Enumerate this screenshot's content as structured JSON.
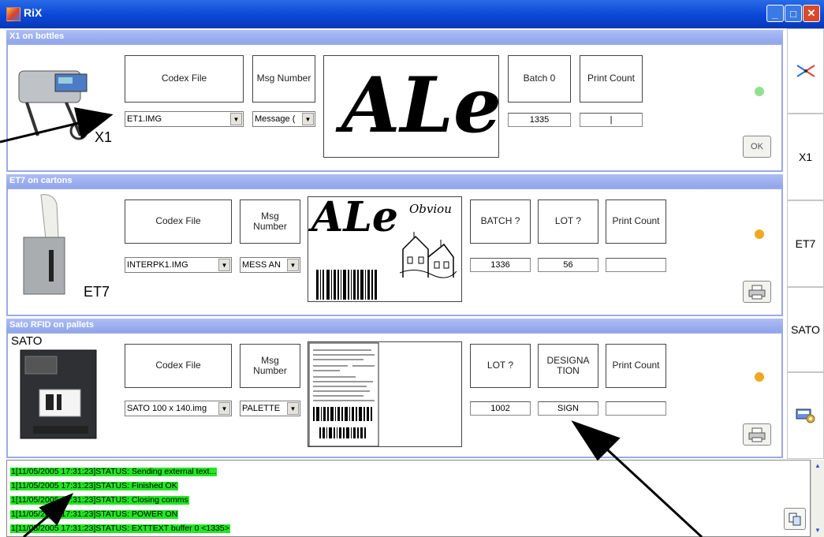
{
  "window": {
    "title": "RiX"
  },
  "sections": [
    {
      "header": "X1 on bottles",
      "device_label": "X1",
      "codex_label": "Codex File",
      "codex_value": "ET1.IMG",
      "msg_label": "Msg Number",
      "msg_value": "Message (",
      "preview_text": "ALe",
      "fields": [
        {
          "label": "Batch 0",
          "value": "1335"
        },
        {
          "label": "Print Count",
          "value": "|"
        }
      ],
      "status_color": "#90e090",
      "button_text": "OK"
    },
    {
      "header": "ET7 on cartons",
      "device_label": "ET7",
      "codex_label": "Codex File",
      "codex_value": "INTERPK1.IMG",
      "msg_label": "Msg Number",
      "msg_value": "MESS AN",
      "preview_text": "ALe",
      "preview_script": "Obviou",
      "fields": [
        {
          "label": "BATCH ?",
          "value": "1336"
        },
        {
          "label": "LOT ?",
          "value": "56"
        },
        {
          "label": "Print Count",
          "value": ""
        }
      ],
      "status_color": "#f0a820"
    },
    {
      "header": "Sato RFID on pallets",
      "device_label": "SATO",
      "codex_label": "Codex File",
      "codex_value": "SATO 100 x 140.img",
      "msg_label": "Msg Number",
      "msg_value": "PALETTE",
      "fields": [
        {
          "label": "LOT ?",
          "value": "1002"
        },
        {
          "label": "DESIGNATION",
          "value": "SIGN"
        },
        {
          "label": "Print Count",
          "value": ""
        }
      ],
      "status_color": "#f0a820"
    }
  ],
  "sidebar": {
    "tabs": [
      "X1",
      "ET7",
      "SATO"
    ]
  },
  "log": {
    "lines": [
      "1[11/05/2005 17:31:23]STATUS: Sending external text...",
      "1[11/05/2005 17:31:23]STATUS: Finished OK",
      "1[11/05/2005 17:31:23]STATUS: Closing comms",
      "1[11/05/2005 17:31:23]STATUS: POWER ON",
      "1[11/05/2005 17:31:23]STATUS: EXTTEXT buffer 0 <1335>"
    ]
  },
  "colors": {
    "titlebar": "#0a47d6",
    "section_header": "#8fa5ec",
    "log_highlight": "#22e622"
  },
  "icons": [
    "app-icon",
    "minimize-icon",
    "maximize-icon",
    "close-icon",
    "connection-icon",
    "settings-icon",
    "printer-icon",
    "copy-icon"
  ]
}
